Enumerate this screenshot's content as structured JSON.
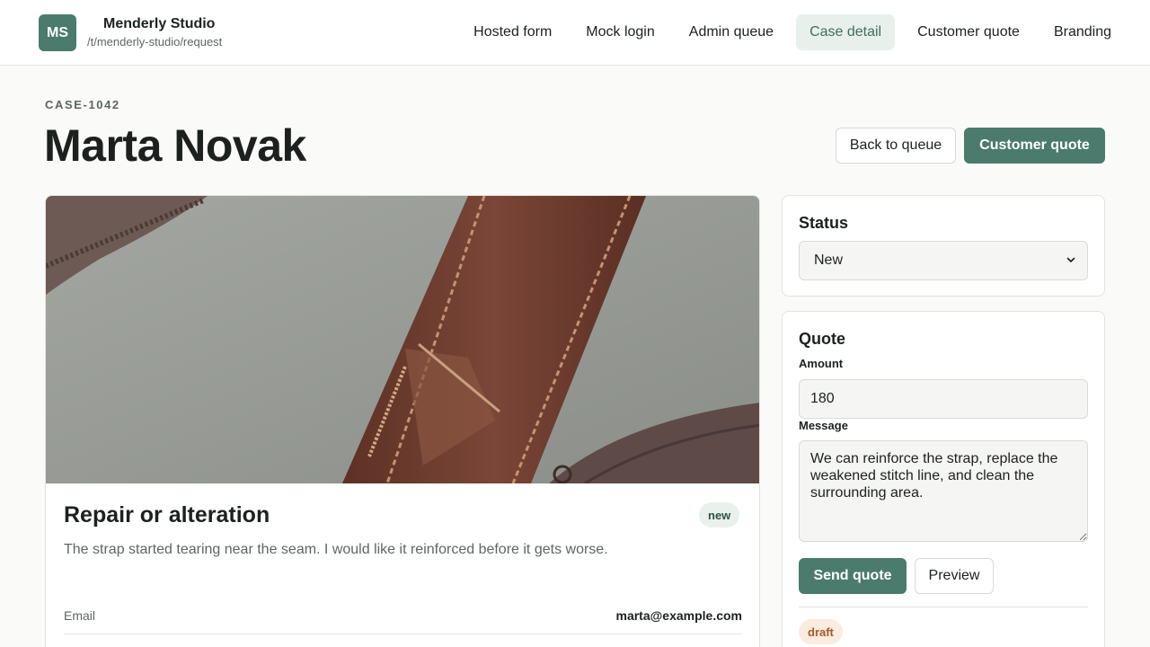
{
  "app": {
    "logo_initials": "MS",
    "name": "Menderly Studio",
    "path": "/t/menderly-studio/request"
  },
  "nav": {
    "items": [
      {
        "label": "Hosted form",
        "active": false
      },
      {
        "label": "Mock login",
        "active": false
      },
      {
        "label": "Admin queue",
        "active": false
      },
      {
        "label": "Case detail",
        "active": true
      },
      {
        "label": "Customer quote",
        "active": false
      },
      {
        "label": "Branding",
        "active": false
      }
    ]
  },
  "case": {
    "id": "CASE-1042",
    "customer_name": "Marta Novak",
    "actions": {
      "back_label": "Back to queue",
      "quote_label": "Customer quote"
    },
    "request": {
      "title": "Repair or alteration",
      "badge": "new",
      "description": "The strap started tearing near the seam. I would like it reinforced before it gets worse.",
      "email_label": "Email",
      "email_value": "marta@example.com"
    }
  },
  "status_panel": {
    "title": "Status",
    "selected": "New"
  },
  "quote_panel": {
    "title": "Quote",
    "amount_label": "Amount",
    "amount_value": "180",
    "message_label": "Message",
    "message_value": "We can reinforce the strap, replace the weakened stitch line, and clean the surrounding area.",
    "send_label": "Send quote",
    "preview_label": "Preview",
    "state_badge": "draft"
  },
  "colors": {
    "accent": "#4a7b6c",
    "accent_soft": "#e8f0ec",
    "draft_bg": "#fcebdf",
    "draft_text": "#a5582b"
  }
}
